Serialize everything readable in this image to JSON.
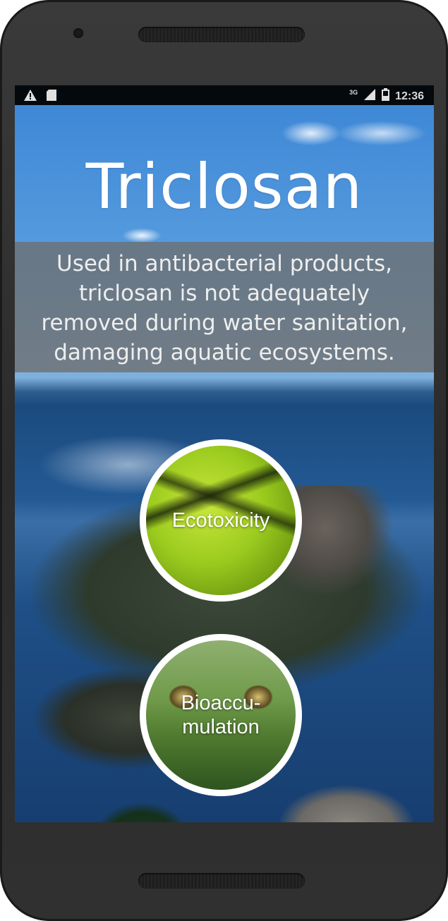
{
  "status_bar": {
    "left_icons": [
      "warning-icon",
      "sd-card-icon"
    ],
    "network": "3G",
    "time": "12:36"
  },
  "hero": {
    "title": "Triclosan",
    "description_lines": [
      "Used in antibacterial products,",
      "triclosan is not adequately",
      "removed during water sanitation,",
      "damaging aquatic ecosystems."
    ]
  },
  "topics": [
    {
      "label": "Ecotoxicity"
    },
    {
      "label_lines": [
        "Bioaccu-",
        "mulation"
      ]
    }
  ]
}
